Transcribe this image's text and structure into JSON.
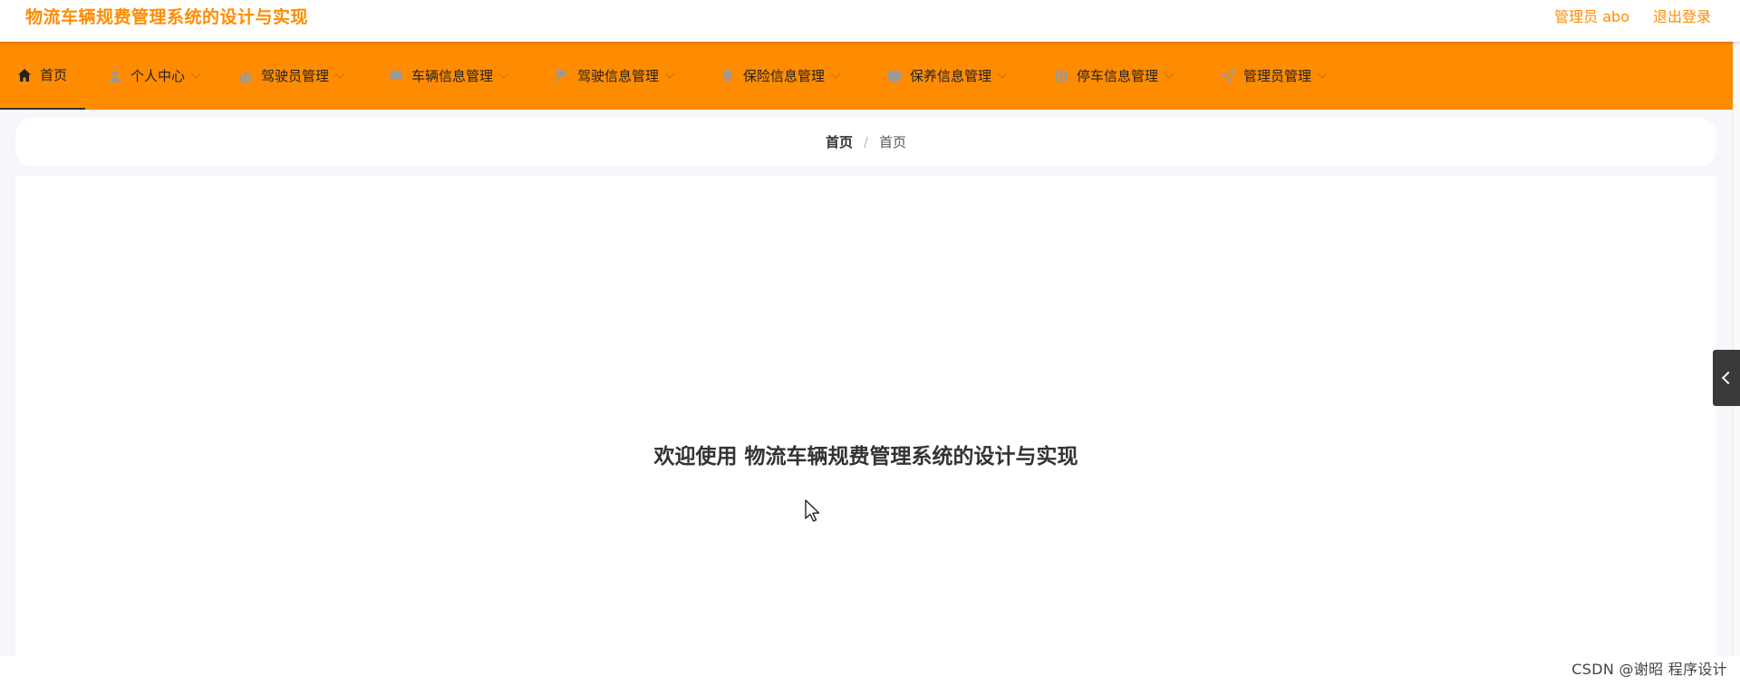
{
  "header": {
    "app_title": "物流车辆规费管理系统的设计与实现",
    "admin_label": "管理员 abo",
    "logout_label": "退出登录"
  },
  "nav": {
    "items": [
      {
        "label": "首页",
        "icon": "home-icon",
        "active": true,
        "has_dropdown": false
      },
      {
        "label": "个人中心",
        "icon": "user-icon",
        "active": false,
        "has_dropdown": true
      },
      {
        "label": "驾驶员管理",
        "icon": "bar-chart-icon",
        "active": false,
        "has_dropdown": true
      },
      {
        "label": "车辆信息管理",
        "icon": "chat-icon",
        "active": false,
        "has_dropdown": true
      },
      {
        "label": "驾驶信息管理",
        "icon": "flag-icon",
        "active": false,
        "has_dropdown": true
      },
      {
        "label": "保险信息管理",
        "icon": "lightbulb-icon",
        "active": false,
        "has_dropdown": true
      },
      {
        "label": "保养信息管理",
        "icon": "shield-icon",
        "active": false,
        "has_dropdown": true
      },
      {
        "label": "停车信息管理",
        "icon": "grid-icon",
        "active": false,
        "has_dropdown": true
      },
      {
        "label": "管理员管理",
        "icon": "send-icon",
        "active": false,
        "has_dropdown": true
      }
    ]
  },
  "breadcrumb": {
    "first": "首页",
    "separator": "/",
    "current": "首页"
  },
  "main": {
    "welcome": "欢迎使用 物流车辆规费管理系统的设计与实现"
  },
  "watermark": "CSDN @谢昭  程序设计",
  "colors": {
    "accent": "#ff8c00",
    "background": "#f6f7fb"
  }
}
